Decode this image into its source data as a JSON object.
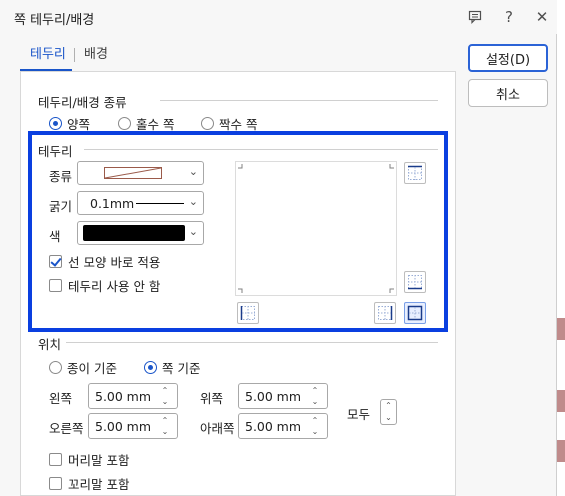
{
  "window": {
    "title": "쪽 테두리/배경"
  },
  "titlebar_icons": {
    "help": "?",
    "close": "✕"
  },
  "tabs": [
    {
      "label": "테두리",
      "active": true
    },
    {
      "label": "배경",
      "active": false
    }
  ],
  "buttons": {
    "ok": "설정(D)",
    "cancel": "취소"
  },
  "apply_group": {
    "title": "테두리/배경 종류",
    "options": [
      {
        "label": "양쪽",
        "selected": true
      },
      {
        "label": "홀수 쪽",
        "selected": false
      },
      {
        "label": "짝수 쪽",
        "selected": false
      }
    ]
  },
  "border_group": {
    "title": "테두리",
    "type_label": "종류",
    "width_label": "굵기",
    "width_value": "0.1mm",
    "color_label": "색",
    "color_value": "#000000",
    "apply_immediately": {
      "label": "선 모양 바로 적용",
      "checked": true
    },
    "no_border": {
      "label": "테두리 사용 안 함",
      "checked": false
    }
  },
  "position_group": {
    "title": "위치",
    "options": [
      {
        "label": "종이 기준",
        "selected": false
      },
      {
        "label": "쪽 기준",
        "selected": true
      }
    ],
    "left": {
      "label": "왼쪽",
      "value": "5.00",
      "unit": "mm"
    },
    "top": {
      "label": "위쪽",
      "value": "5.00",
      "unit": "mm"
    },
    "right": {
      "label": "오른쪽",
      "value": "5.00",
      "unit": "mm"
    },
    "bottom": {
      "label": "아래쪽",
      "value": "5.00",
      "unit": "mm"
    },
    "all_label": "모두",
    "include_header": {
      "label": "머리말 포함",
      "checked": false
    },
    "include_footer": {
      "label": "꼬리말 포함",
      "checked": false
    }
  },
  "colors": {
    "accent": "#1a55c9",
    "highlight_frame": "#0a3fe0"
  }
}
